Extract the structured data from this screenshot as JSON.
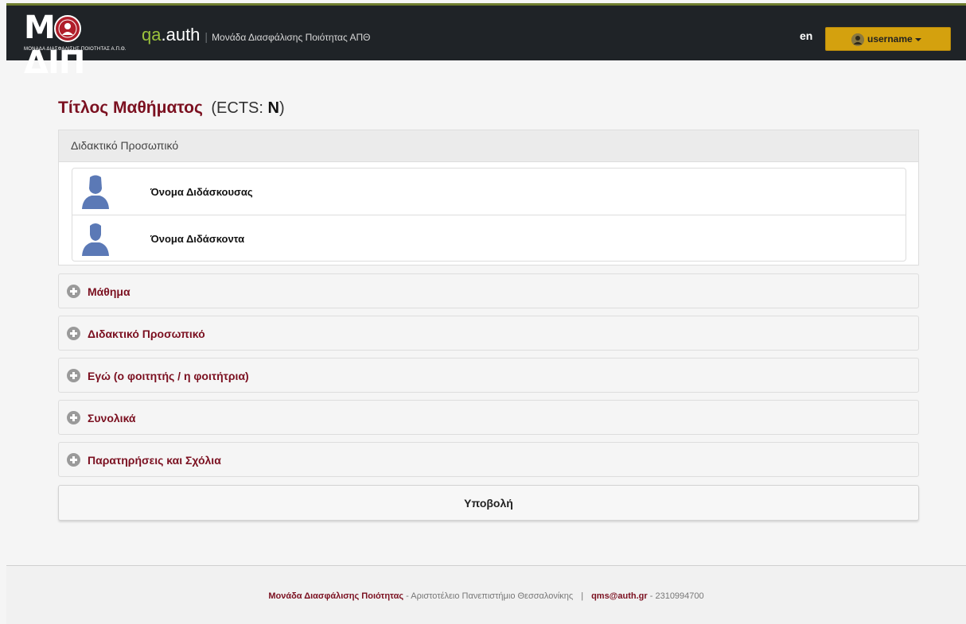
{
  "navbar": {
    "logo_text": "ΜΟΔΙΠ",
    "logo_subtitle": "ΜΟΝΑΔΑ ΔΙΑΣΦΑΛΙΣΗΣ ΠΟΙΟΤΗΤΑΣ Α.Π.Θ.",
    "brand_qa": "qa",
    "brand_auth": ".auth",
    "brand_separator": "|",
    "brand_description": "Μονάδα Διασφάλισης Ποιότητας ΑΠΘ",
    "language": "en",
    "username": "username",
    "user_icon": "user-icon",
    "colors": {
      "bar": "#1f2327",
      "accent_line": "#6f7d2e",
      "brand_qa": "#9bc23c",
      "user_button": "#d4a10e"
    }
  },
  "course": {
    "title": "Τίτλος Μαθήματος",
    "ects_prefix": "(ECTS: ",
    "ects_value": "N",
    "ects_suffix": ")"
  },
  "staff": {
    "heading": "Διδακτικό Προσωπικό",
    "members": [
      {
        "name": "Όνομα Διδάσκουσας",
        "icon": "female-user-icon"
      },
      {
        "name": "Όνομα Διδάσκοντα",
        "icon": "male-user-icon"
      }
    ]
  },
  "sections": [
    {
      "label": "Μάθημα",
      "icon": "plus-circle-icon"
    },
    {
      "label": "Διδακτικό Προσωπικό",
      "icon": "plus-circle-icon"
    },
    {
      "label": "Εγώ (ο φοιτητής / η φοιτήτρια)",
      "icon": "plus-circle-icon"
    },
    {
      "label": "Συνολικά",
      "icon": "plus-circle-icon"
    },
    {
      "label": "Παρατηρήσεις και Σχόλια",
      "icon": "plus-circle-icon"
    }
  ],
  "submit_label": "Υποβολή",
  "footer": {
    "org": "Μονάδα Διασφάλισης Ποιότητας",
    "university": " - Αριστοτέλειο Πανεπιστήμιο Θεσσαλονίκης",
    "separator": "|",
    "email": "qms@auth.gr",
    "phone": " - 2310994700"
  },
  "colors": {
    "accent": "#7b1020",
    "page_bg": "#f5f5f5"
  }
}
